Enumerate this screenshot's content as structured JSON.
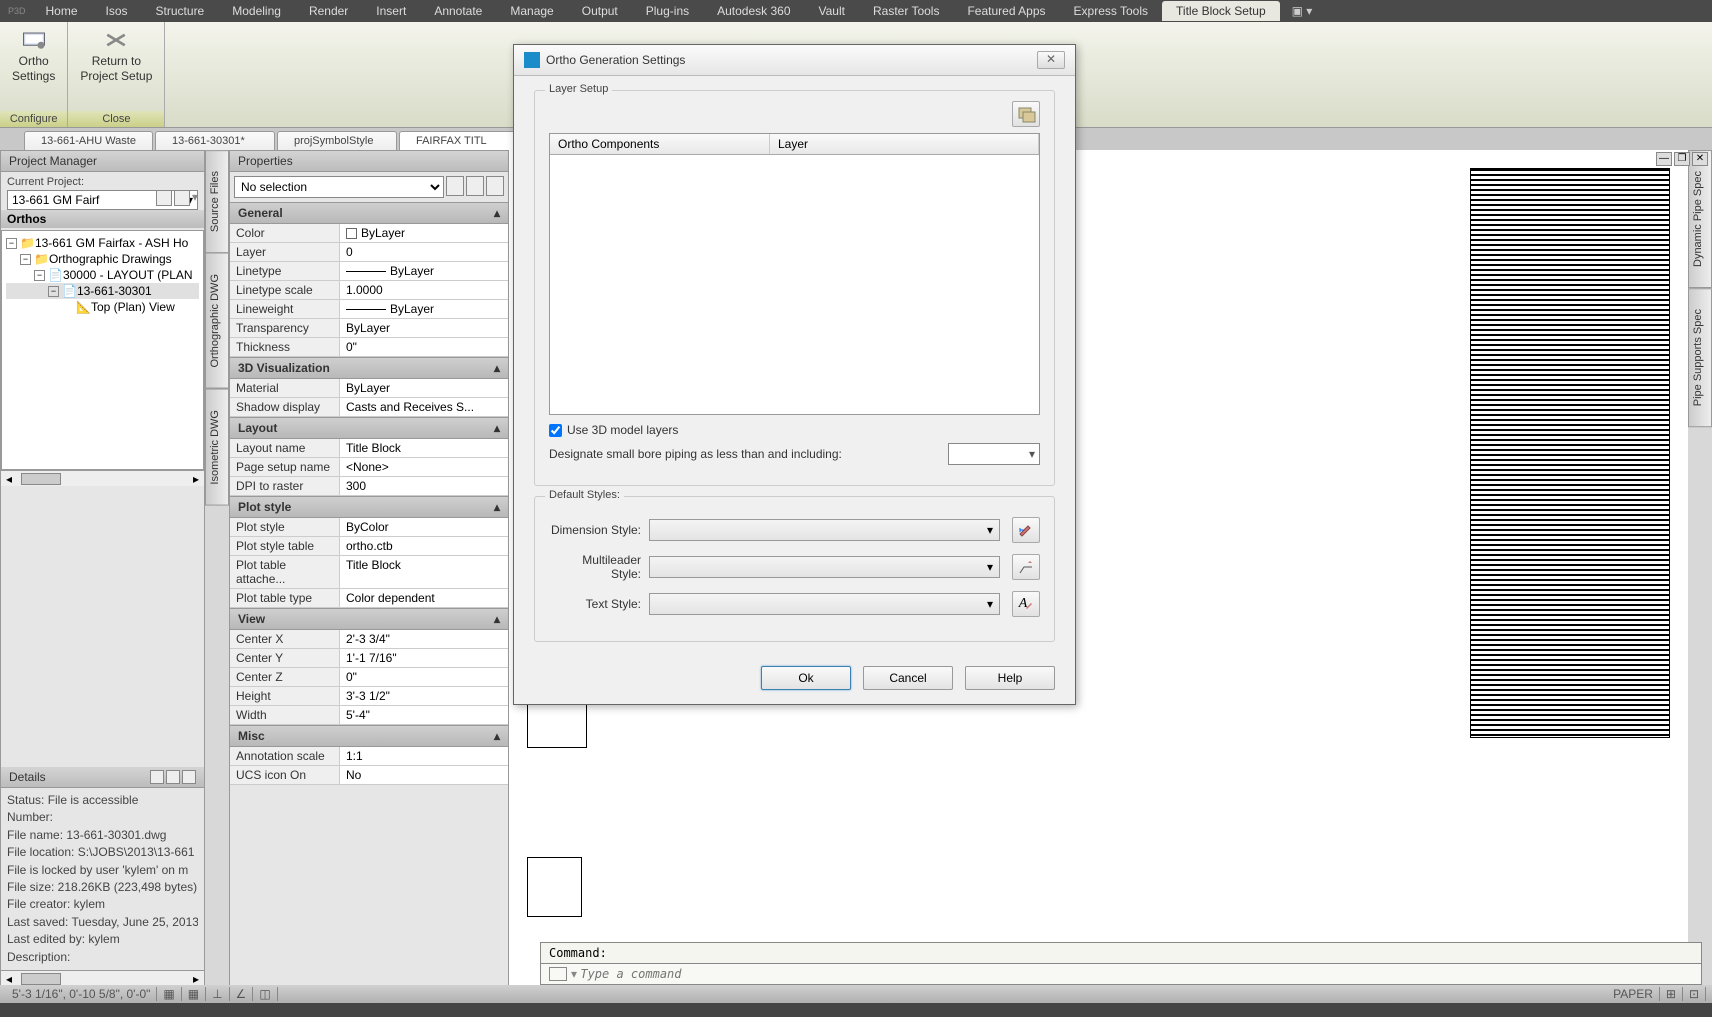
{
  "menubar": {
    "small": "P3D",
    "tabs": [
      "Home",
      "Isos",
      "Structure",
      "Modeling",
      "Render",
      "Insert",
      "Annotate",
      "Manage",
      "Output",
      "Plug-ins",
      "Autodesk 360",
      "Vault",
      "Raster Tools",
      "Featured Apps",
      "Express Tools",
      "Title Block Setup"
    ],
    "active": 15
  },
  "ribbon": {
    "btn1_l1": "Ortho",
    "btn1_l2": "Settings",
    "btn2_l1": "Return to",
    "btn2_l2": "Project Setup",
    "footer1": "Configure",
    "footer2": "Close"
  },
  "doctabs": [
    "13-661-AHU Waste",
    "13-661-30301*",
    "projSymbolStyle",
    "FAIRFAX TITL"
  ],
  "doctab_active": 3,
  "pm": {
    "title": "Project Manager",
    "current_label": "Current Project:",
    "current_value": "13-661  GM Fairf",
    "orthos": "Orthos",
    "tree": {
      "n0": "13-661 GM Fairfax - ASH Ho",
      "n1": "Orthographic Drawings",
      "n2": "30000 - LAYOUT (PLAN",
      "n3": "13-661-30301",
      "n4": "Top (Plan) View"
    },
    "details_title": "Details",
    "details": {
      "l0": "Status: File is accessible",
      "l1": "Number:",
      "l2": "File  name:  13-661-30301.dwg",
      "l3": "File location:  S:\\JOBS\\2013\\13-661",
      "l4": "File is locked by user 'kylem' on m",
      "l5": "File size:  218.26KB  (223,498 bytes)",
      "l6": "File creator: kylem",
      "l7": "Last saved:  Tuesday, June 25, 2013",
      "l8": "Last edited by: kylem",
      "l9": "Description:"
    }
  },
  "sidetabs": [
    "Source Files",
    "Orthographic DWG",
    "Isometric DWG"
  ],
  "rsidetabs": [
    "Dynamic Pipe Spec",
    "Pipe Supports Spec"
  ],
  "props": {
    "title": "Properties",
    "selection": "No selection",
    "groups": {
      "general": "General",
      "viz": "3D Visualization",
      "layout": "Layout",
      "plot": "Plot style",
      "view": "View",
      "misc": "Misc"
    },
    "rows": {
      "color_k": "Color",
      "color_v": "ByLayer",
      "layer_k": "Layer",
      "layer_v": "0",
      "lt_k": "Linetype",
      "lt_v": "ByLayer",
      "lts_k": "Linetype scale",
      "lts_v": "1.0000",
      "lw_k": "Lineweight",
      "lw_v": "ByLayer",
      "tr_k": "Transparency",
      "tr_v": "ByLayer",
      "th_k": "Thickness",
      "th_v": "0\"",
      "mat_k": "Material",
      "mat_v": "ByLayer",
      "sh_k": "Shadow display",
      "sh_v": "Casts and Receives S...",
      "ln_k": "Layout name",
      "ln_v": "Title Block",
      "ps_k": "Page setup name",
      "ps_v": "<None>",
      "dpi_k": "DPI to raster",
      "dpi_v": "300",
      "pst_k": "Plot style",
      "pst_v": "ByColor",
      "pstb_k": "Plot style table",
      "pstb_v": "ortho.ctb",
      "pta_k": "Plot table attache...",
      "pta_v": "Title Block",
      "ptt_k": "Plot table type",
      "ptt_v": "Color dependent",
      "cx_k": "Center X",
      "cx_v": "2'-3 3/4\"",
      "cy_k": "Center Y",
      "cy_v": "1'-1 7/16\"",
      "cz_k": "Center Z",
      "cz_v": "0\"",
      "h_k": "Height",
      "h_v": "3'-3 1/2\"",
      "w_k": "Width",
      "w_v": "5'-4\"",
      "as_k": "Annotation scale",
      "as_v": "1:1",
      "ui_k": "UCS icon On",
      "ui_v": "No"
    }
  },
  "dialog": {
    "title": "Ortho Generation Settings",
    "layer_setup": "Layer Setup",
    "col1": "Ortho Components",
    "col2": "Layer",
    "use3d": "Use 3D model layers",
    "designate": "Designate small bore piping as less than and including:",
    "default_styles": "Default Styles:",
    "dim": "Dimension Style:",
    "ml": "Multileader Style:",
    "txt": "Text Style:",
    "ok": "Ok",
    "cancel": "Cancel",
    "help": "Help"
  },
  "cmd": {
    "hist": "Command:",
    "placeholder": "Type a command"
  },
  "status": {
    "coords": "5'-3 1/16\", 0'-10 5/8\", 0'-0\"",
    "paper": "PAPER"
  }
}
